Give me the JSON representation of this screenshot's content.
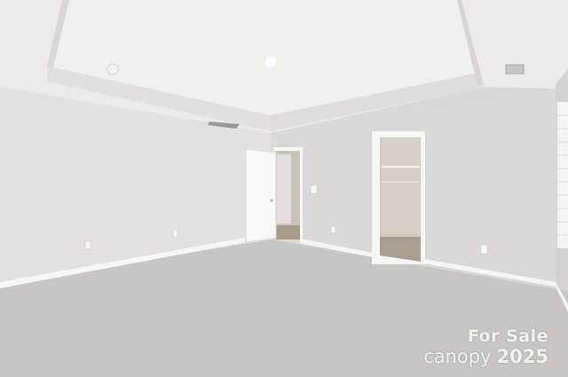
{
  "image": {
    "subject": "empty bedroom interior",
    "colors": {
      "ceiling": "#efefee",
      "tray_ceiling": "#e6e6e4",
      "wall_left": "#e3e2e0",
      "wall_back": "#dcdbd9",
      "carpet": "#c9c7c4",
      "trim": "#f7f7f5",
      "closet_wall": "#cfc9c0"
    }
  },
  "watermark": {
    "line1": "For Sale",
    "brand": "canopy",
    "year": "2025"
  }
}
